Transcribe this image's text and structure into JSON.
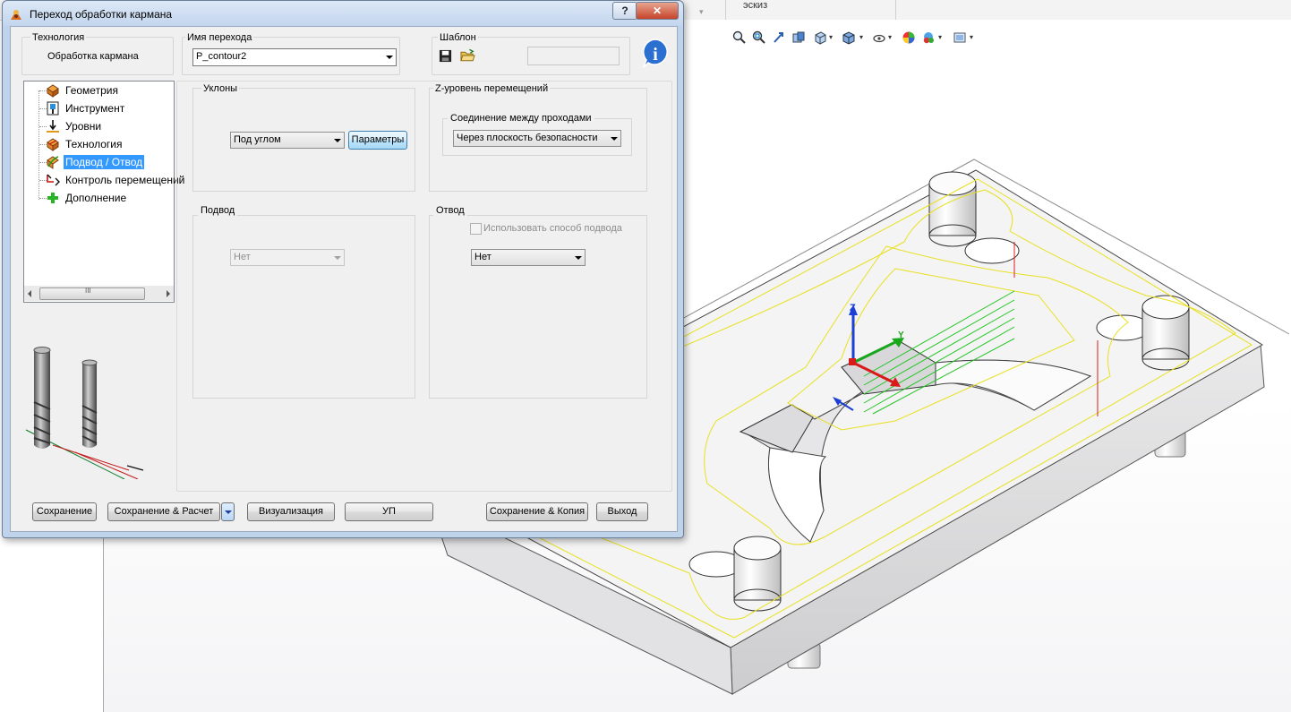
{
  "cad": {
    "tab_label": "эскиз",
    "toolbar_icons": [
      "zoom-to-fit-icon",
      "zoom-area-icon",
      "previous-view-icon",
      "section-view-icon",
      "view-orientation-icon",
      "display-style-icon",
      "hide-show-icon",
      "edit-appearance-icon",
      "apply-scene-icon",
      "view-settings-icon"
    ]
  },
  "dialog": {
    "title": "Переход обработки кармана",
    "help_glyph": "?",
    "close_glyph": "✕",
    "technology_group": {
      "label": "Технология",
      "value": "Обработка кармана"
    },
    "step_name_group": {
      "label": "Имя перехода",
      "value": "P_contour2"
    },
    "template_group": {
      "label": "Шаблон",
      "field_value": ""
    },
    "info_glyph": "i",
    "tree": {
      "items": [
        {
          "label": "Геометрия",
          "icon": "geometry-icon",
          "selected": false
        },
        {
          "label": "Инструмент",
          "icon": "tool-icon",
          "selected": false
        },
        {
          "label": "Уровни",
          "icon": "levels-icon",
          "selected": false
        },
        {
          "label": "Технология",
          "icon": "technology-icon",
          "selected": false
        },
        {
          "label": "Подвод / Отвод",
          "icon": "approach-retract-icon",
          "selected": true
        },
        {
          "label": "Контроль перемещений",
          "icon": "motion-control-icon",
          "selected": false
        },
        {
          "label": "Дополнение",
          "icon": "addition-icon",
          "selected": false
        }
      ],
      "scroll_thumb_glyph": "III"
    },
    "slopes": {
      "label": "Уклоны",
      "combo_value": "Под углом",
      "params_button": "Параметры"
    },
    "z_level": {
      "label": "Z-уровень перемещений",
      "connection_label": "Соединение между проходами",
      "combo_value": "Через плоскость безопасности"
    },
    "approach": {
      "label": "Подвод",
      "combo_value": "Нет"
    },
    "retract": {
      "label": "Отвод",
      "checkbox_label": "Использовать способ подвода",
      "checked": false,
      "combo_value": "Нет"
    },
    "buttons": {
      "save": "Сохранение",
      "save_calc": "Сохранение & Расчет",
      "visualize": "Визуализация",
      "nc": "УП",
      "save_copy": "Сохранение & Копия",
      "exit": "Выход"
    }
  }
}
